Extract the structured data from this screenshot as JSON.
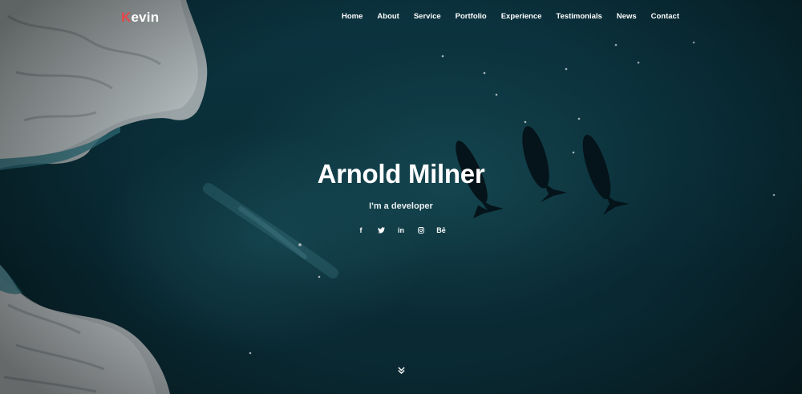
{
  "brand": {
    "first_letter": "K",
    "rest": "evin",
    "accent_color": "#e8454a"
  },
  "nav": {
    "items": [
      {
        "label": "Home"
      },
      {
        "label": "About"
      },
      {
        "label": "Service"
      },
      {
        "label": "Portfolio"
      },
      {
        "label": "Experience"
      },
      {
        "label": "Testimonials"
      },
      {
        "label": "News"
      },
      {
        "label": "Contact"
      }
    ]
  },
  "hero": {
    "title": "Arnold Milner",
    "subtitle": "I'm a developer",
    "background": "aerial ocean with icebergs and whales",
    "social": [
      {
        "icon": "facebook-icon",
        "glyph": "f"
      },
      {
        "icon": "twitter-icon",
        "glyph": ""
      },
      {
        "icon": "linkedin-icon",
        "glyph": "in"
      },
      {
        "icon": "instagram-icon",
        "glyph": ""
      },
      {
        "icon": "behance-icon",
        "glyph": "Bē"
      }
    ],
    "scroll_icon": "double-chevron-down-icon"
  },
  "colors": {
    "ocean": "#0a2e38",
    "text": "#ffffff"
  }
}
